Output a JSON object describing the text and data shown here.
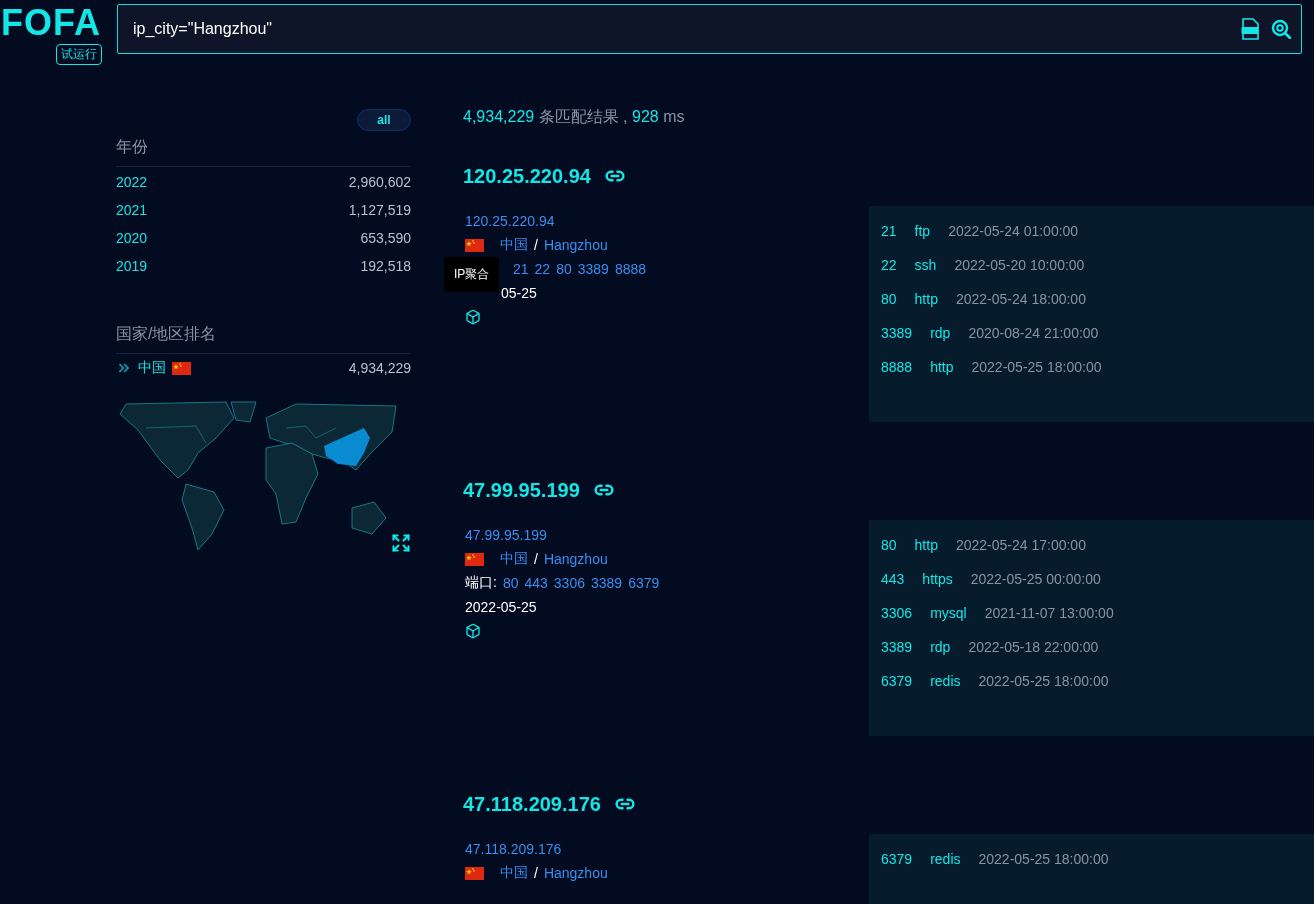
{
  "logo": {
    "text": "FOFA",
    "badge": "试运行"
  },
  "search": {
    "value": "ip_city=\"Hangzhou\""
  },
  "sidebar": {
    "filter_button": "all",
    "year_section": {
      "title": "年份",
      "items": [
        {
          "label": "2022",
          "count": "2,960,602"
        },
        {
          "label": "2021",
          "count": "1,127,519"
        },
        {
          "label": "2020",
          "count": "653,590"
        },
        {
          "label": "2019",
          "count": "192,518"
        }
      ]
    },
    "country_section": {
      "title": "国家/地区排名",
      "items": [
        {
          "label": "中国",
          "count": "4,934,229"
        }
      ]
    }
  },
  "summary": {
    "count": "4,934,229",
    "label": "条匹配结果",
    "separator": ",",
    "time": "928",
    "unit": "ms"
  },
  "results": [
    {
      "title": "120.25.220.94",
      "ip": "120.25.220.94",
      "country": "中国",
      "separator": "/",
      "city": "Hangzhou",
      "tooltip": "IP聚合",
      "ports": [
        "21",
        "22",
        "80",
        "3389",
        "8888"
      ],
      "date": "05-25",
      "services": [
        {
          "port": "21",
          "protocol": "ftp",
          "time": "2022-05-24 01:00:00"
        },
        {
          "port": "22",
          "protocol": "ssh",
          "time": "2022-05-20 10:00:00"
        },
        {
          "port": "80",
          "protocol": "http",
          "time": "2022-05-24 18:00:00"
        },
        {
          "port": "3389",
          "protocol": "rdp",
          "time": "2020-08-24 21:00:00"
        },
        {
          "port": "8888",
          "protocol": "http",
          "time": "2022-05-25 18:00:00"
        }
      ]
    },
    {
      "title": "47.99.95.199",
      "ip": "47.99.95.199",
      "country": "中国",
      "separator": "/",
      "city": "Hangzhou",
      "port_label": "端口:",
      "ports": [
        "80",
        "443",
        "3306",
        "3389",
        "6379"
      ],
      "date": "2022-05-25",
      "services": [
        {
          "port": "80",
          "protocol": "http",
          "time": "2022-05-24 17:00:00"
        },
        {
          "port": "443",
          "protocol": "https",
          "time": "2022-05-25 00:00:00"
        },
        {
          "port": "3306",
          "protocol": "mysql",
          "time": "2021-11-07 13:00:00"
        },
        {
          "port": "3389",
          "protocol": "rdp",
          "time": "2022-05-18 22:00:00"
        },
        {
          "port": "6379",
          "protocol": "redis",
          "time": "2022-05-25 18:00:00"
        }
      ]
    },
    {
      "title": "47.118.209.176",
      "ip": "47.118.209.176",
      "country": "中国",
      "separator": "/",
      "city": "Hangzhou",
      "services": [
        {
          "port": "6379",
          "protocol": "redis",
          "time": "2022-05-25 18:00:00"
        }
      ]
    }
  ]
}
